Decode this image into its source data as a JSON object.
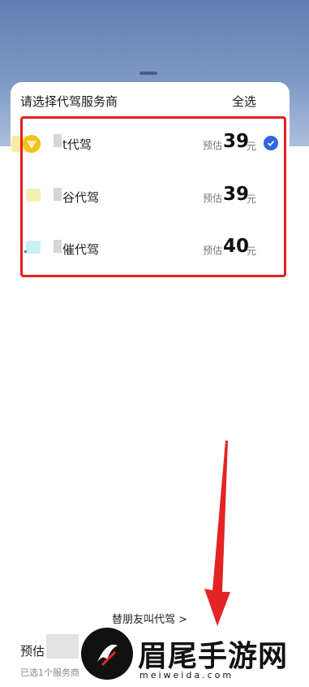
{
  "sheet": {
    "title": "请选择代驾服务商",
    "select_all": "全选"
  },
  "providers": [
    {
      "name": "t代驾",
      "estimate_label": "预估",
      "price": "39",
      "unit": "元",
      "selected": true,
      "logo_color": "#f5c01c"
    },
    {
      "name": "谷代驾",
      "estimate_label": "预估",
      "price": "39",
      "unit": "元",
      "selected": false,
      "logo_color": "#f4f0b4"
    },
    {
      "name": "催代驾",
      "estimate_label": "预估",
      "price": "40",
      "unit": "元",
      "selected": false,
      "logo_color": "#c9f0f7"
    }
  ],
  "footer": {
    "friend_link": "替朋友叫代驾 >",
    "estimate_prefix": "预估",
    "selected_count": "已选1个服务商"
  },
  "watermark": {
    "title": "眉尾手游网",
    "url": "meiweida.com"
  },
  "colors": {
    "accent": "#2f67e0",
    "highlight": "#e32222",
    "header_bg": "#7d98c5"
  }
}
